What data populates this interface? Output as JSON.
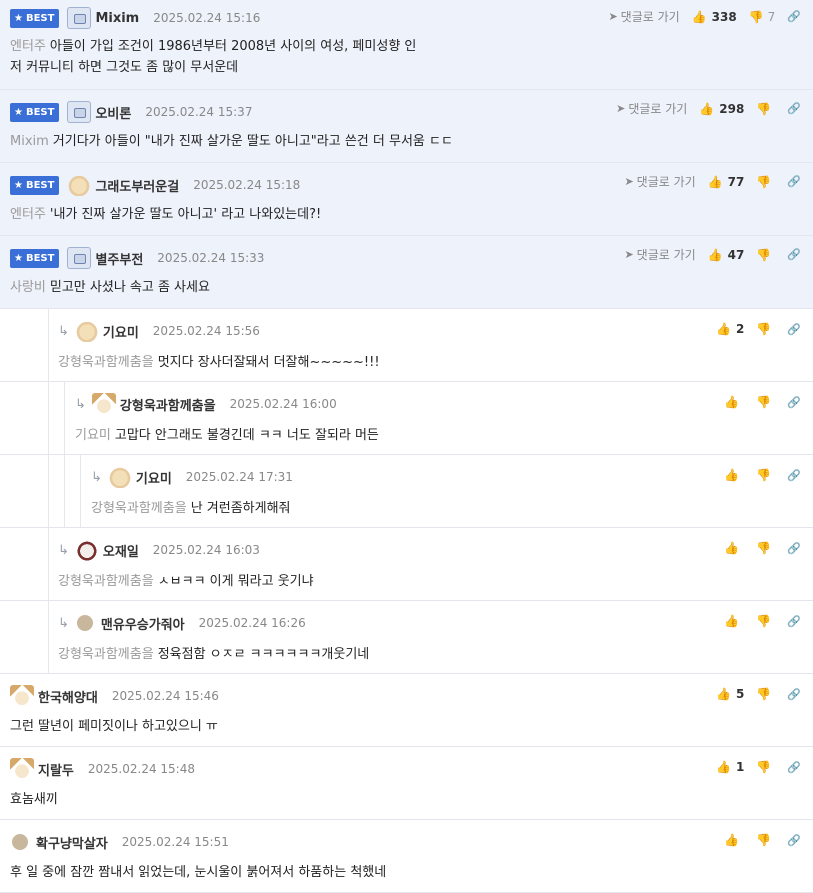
{
  "comments": [
    {
      "best": true,
      "badge": "BEST",
      "avatar": "robot",
      "name": "Mixim",
      "date": "2025.02.24 15:16",
      "goto": "댓글로 가기",
      "likes": "338",
      "dislikes": "7",
      "mention": "엔터주",
      "text_line1": "아들이 가입 조건이 1986년부터 2008년 사이의 여성, 페미성향 인",
      "text_line2": "저 커뮤니티 하면 그것도 좀 많이 무서운데"
    },
    {
      "best": true,
      "badge": "BEST",
      "avatar": "robot",
      "name": "오비론",
      "date": "2025.02.24 15:37",
      "goto": "댓글로 가기",
      "likes": "298",
      "dislikes": "",
      "mention": "Mixim",
      "text": "거기다가 아들이 \"내가 진짜 살가운 딸도 아니고\"라고 쓴건 더 무서움 ㄷㄷ"
    },
    {
      "best": true,
      "badge": "BEST",
      "avatar": "dog",
      "name": "그래도부러운걸",
      "date": "2025.02.24 15:18",
      "goto": "댓글로 가기",
      "likes": "77",
      "dislikes": "",
      "mention": "엔터주",
      "text": "'내가 진짜 살가운 딸도 아니고' 라고 나와있는데?!"
    },
    {
      "best": true,
      "badge": "BEST",
      "avatar": "robot",
      "name": "별주부전",
      "date": "2025.02.24 15:33",
      "goto": "댓글로 가기",
      "likes": "47",
      "dislikes": "",
      "mention": "사랑비",
      "text": "믿고만 사셨나 속고 좀 사세요"
    },
    {
      "avatar": "dog",
      "name": "기요미",
      "date": "2025.02.24 15:56",
      "likes": "2",
      "dislikes": "",
      "mention": "강형욱과함께춤을",
      "text": "멋지다 장사더잘돼서 더잘해~~~~~!!!"
    },
    {
      "avatar": "fox",
      "name": "강형욱과함께춤을",
      "date": "2025.02.24 16:00",
      "likes": "",
      "dislikes": "",
      "mention": "기요미",
      "text": "고맙다 안그래도 불경긴데 ㅋㅋ 너도 잘되라 머든"
    },
    {
      "avatar": "dog",
      "name": "기요미",
      "date": "2025.02.24 17:31",
      "likes": "",
      "dislikes": "",
      "mention": "강형욱과함께춤을",
      "text": "난 겨런좀하게해줘"
    },
    {
      "avatar": "bear",
      "name": "오재일",
      "date": "2025.02.24 16:03",
      "likes": "",
      "dislikes": "",
      "mention": "강형욱과함께춤을",
      "text": "ㅅㅂㅋㅋ 이게 뭐라고 웃기냐"
    },
    {
      "avatar": "dot",
      "name": "맨유우승가줘아",
      "date": "2025.02.24 16:26",
      "likes": "",
      "dislikes": "",
      "mention": "강형욱과함께춤을",
      "text": "정육점함 ㅇㅈㄹ ㅋㅋㅋㅋㅋㅋ개웃기네"
    },
    {
      "avatar": "fox",
      "name": "한국해양대",
      "date": "2025.02.24 15:46",
      "likes": "5",
      "dislikes": "",
      "text": "그런 딸년이 페미짓이나 하고있으니 ㅠ"
    },
    {
      "avatar": "fox",
      "name": "지랄두",
      "date": "2025.02.24 15:48",
      "likes": "1",
      "dislikes": "",
      "text": "효놈새끼"
    },
    {
      "avatar": "dot",
      "name": "확구냥막살자",
      "date": "2025.02.24 15:51",
      "likes": "",
      "dislikes": "",
      "text": "후 일 중에 잠깐 짬내서 읽었는데, 눈시울이 붉어져서 하품하는 척했네"
    }
  ],
  "icons": {
    "like": "thumbs-up-icon",
    "dislike": "thumbs-down-icon",
    "link": "link-icon",
    "goto": "send-arrow-icon",
    "reply": "reply-arrow-icon",
    "best": "star-icon"
  },
  "colors": {
    "best_bg": "#eef2fb",
    "badge": "#3b6fd8",
    "mention": "#9a9a9a"
  }
}
